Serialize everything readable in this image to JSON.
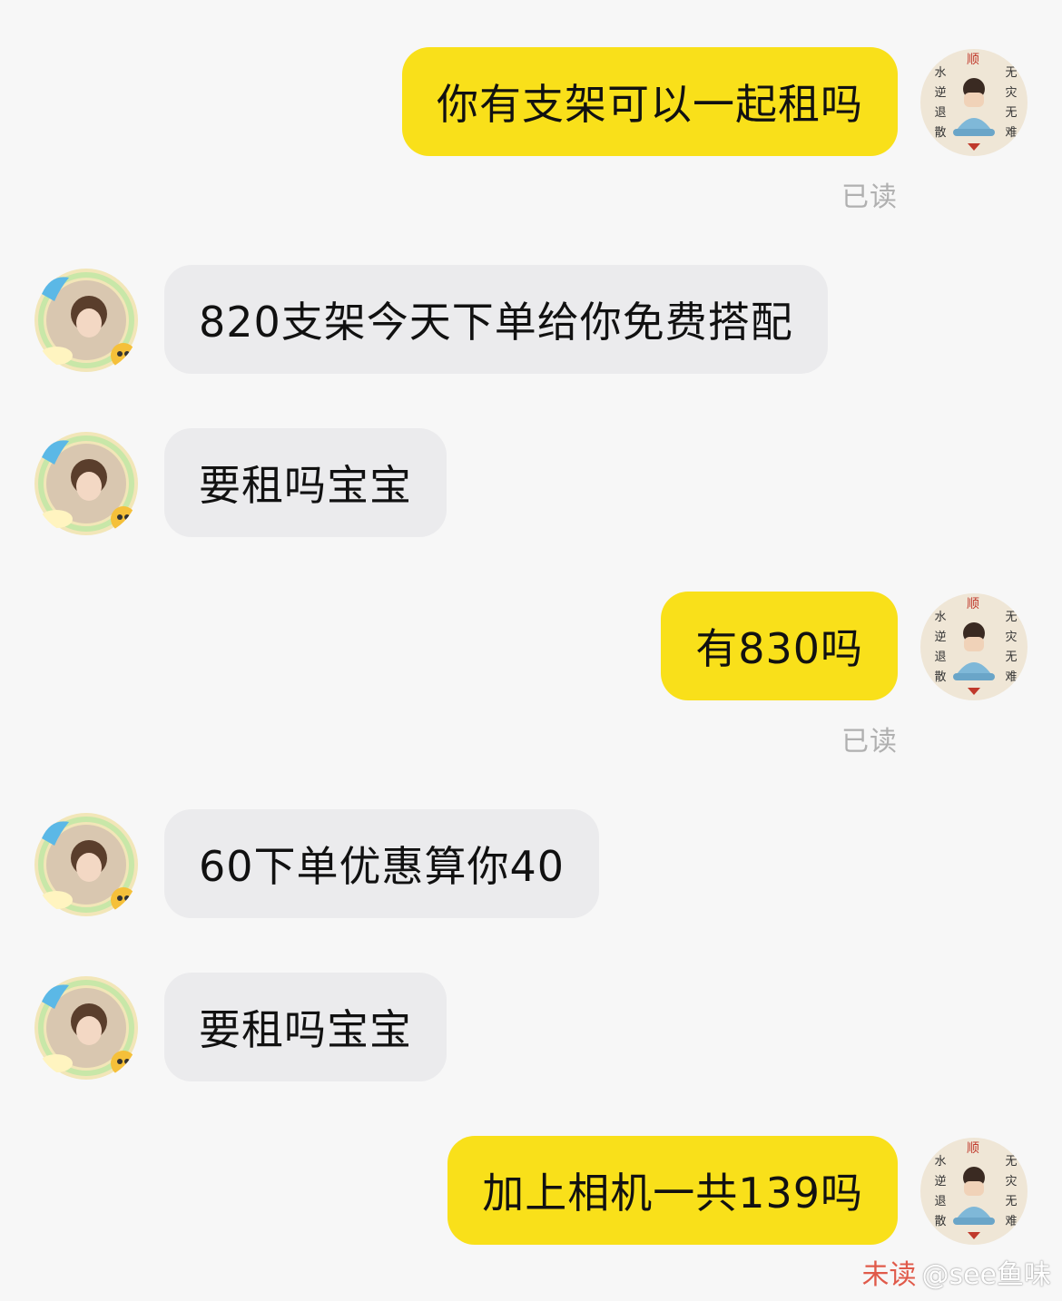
{
  "messages": [
    {
      "side": "mine",
      "text": "你有支架可以一起租吗",
      "status": "已读"
    },
    {
      "side": "theirs",
      "text": "820支架今天下单给你免费搭配"
    },
    {
      "side": "theirs",
      "text": "要租吗宝宝"
    },
    {
      "side": "mine",
      "text": "有830吗",
      "status": "已读"
    },
    {
      "side": "theirs",
      "text": "60下单优惠算你40"
    },
    {
      "side": "theirs",
      "text": "要租吗宝宝"
    },
    {
      "side": "mine",
      "text": "加上相机一共139吗"
    }
  ],
  "avatar_mine": {
    "chars_left": [
      "水",
      "逆",
      "退",
      "散"
    ],
    "chars_right": [
      "无",
      "灾",
      "无",
      "难"
    ],
    "char_top": "顺"
  },
  "watermark": {
    "unread_text": "未读",
    "handle": "@see鱼味"
  },
  "colors": {
    "background": "#f7f7f7",
    "mine_bubble": "#f9e01a",
    "theirs_bubble": "#ebebed",
    "status_text": "#b0b0b0"
  }
}
